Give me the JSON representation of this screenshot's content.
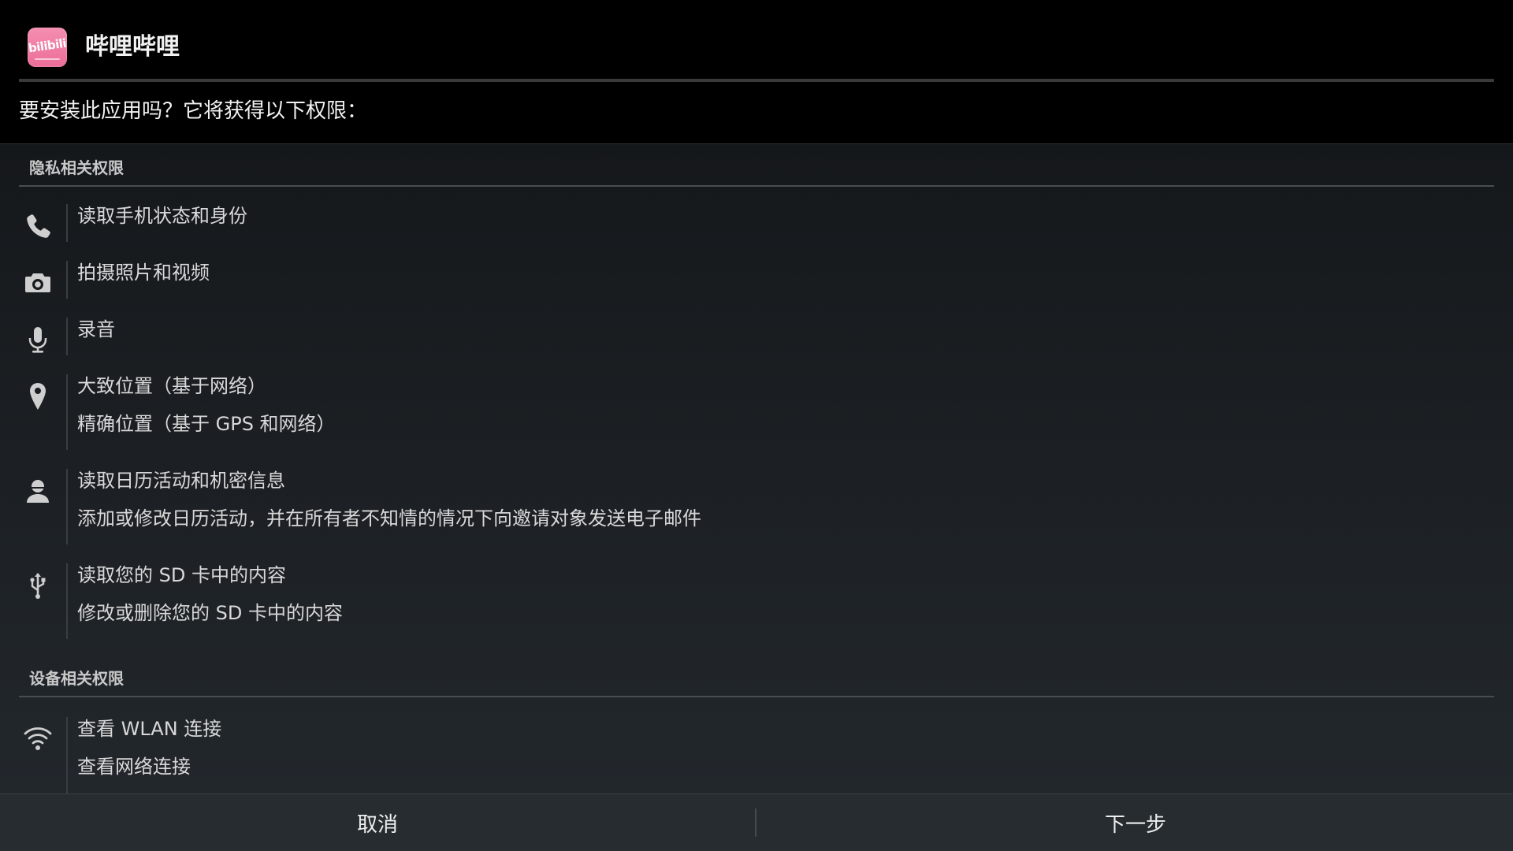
{
  "app": {
    "name": "哔哩哔哩",
    "logo_text": "bilibili"
  },
  "prompt": "要安装此应用吗？它将获得以下权限：",
  "sections": {
    "privacy": {
      "title": "隐私相关权限",
      "groups": [
        {
          "icon": "phone-icon",
          "lines": [
            "读取手机状态和身份"
          ]
        },
        {
          "icon": "camera-icon",
          "lines": [
            "拍摄照片和视频"
          ]
        },
        {
          "icon": "microphone-icon",
          "lines": [
            "录音"
          ]
        },
        {
          "icon": "location-pin-icon",
          "lines": [
            "大致位置（基于网络）",
            "精确位置（基于 GPS 和网络）"
          ]
        },
        {
          "icon": "person-icon",
          "lines": [
            "读取日历活动和机密信息",
            "添加或修改日历活动，并在所有者不知情的情况下向邀请对象发送电子邮件"
          ]
        },
        {
          "icon": "usb-icon",
          "lines": [
            "读取您的 SD 卡中的内容",
            "修改或删除您的 SD 卡中的内容"
          ]
        }
      ]
    },
    "device": {
      "title": "设备相关权限",
      "groups": [
        {
          "icon": "wifi-icon",
          "lines": [
            "查看 WLAN 连接",
            "查看网络连接"
          ]
        }
      ]
    }
  },
  "footer": {
    "cancel_label": "取消",
    "next_label": "下一步"
  }
}
